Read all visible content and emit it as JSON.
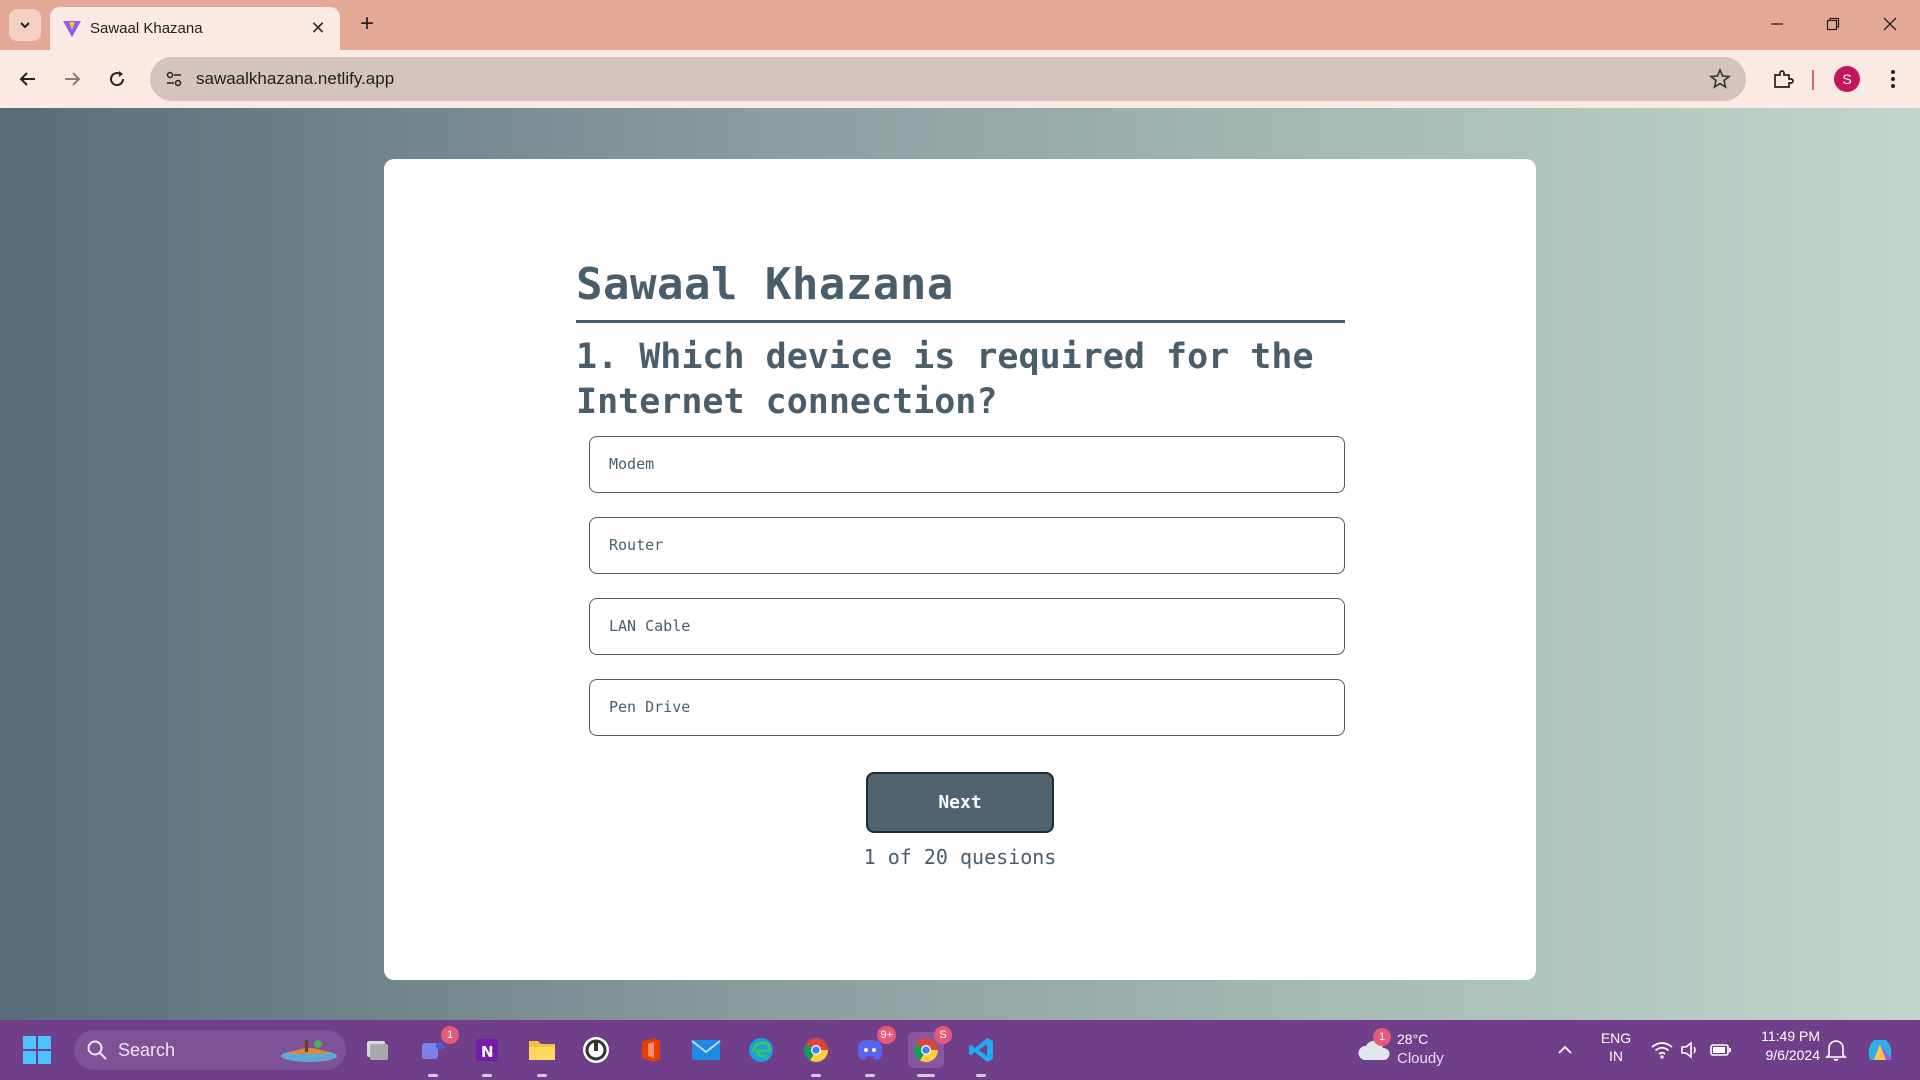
{
  "browser": {
    "tab_title": "Sawaal Khazana",
    "url": "sawaalkhazana.netlify.app",
    "avatar_letter": "S"
  },
  "quiz": {
    "app_title": "Sawaal Khazana",
    "question": "1. Which device is required for the Internet connection?",
    "options": [
      "Modem",
      "Router",
      "LAN Cable",
      "Pen Drive"
    ],
    "next_label": "Next",
    "progress_text": "1 of 20 quesions"
  },
  "taskbar": {
    "search_label": "Search",
    "teams_badge": "1",
    "discord_badge": "9+",
    "chrome_badge": "S",
    "weather_badge": "1",
    "weather_temp": "28°C",
    "weather_desc": "Cloudy",
    "lang": "ENG",
    "region": "IN",
    "time": "11:49 PM",
    "date": "9/6/2024"
  },
  "colors": {
    "accent": "#4a5d6b",
    "tab_strip": "#e4a897",
    "taskbar": "#6f3f8a"
  }
}
